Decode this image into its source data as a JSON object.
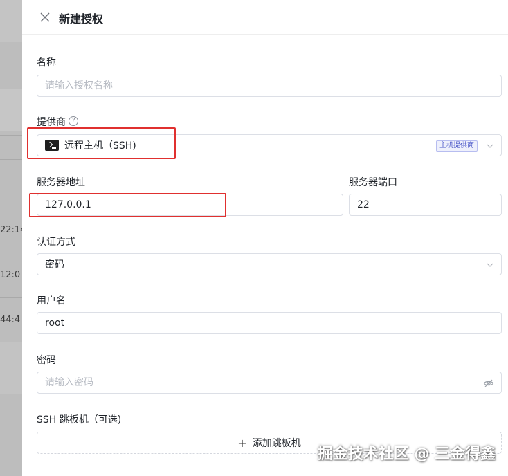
{
  "background": {
    "times": [
      "22:14",
      "12:0",
      "44:4"
    ]
  },
  "drawer": {
    "title": "新建授权"
  },
  "form": {
    "name": {
      "label": "名称",
      "placeholder": "请输入授权名称"
    },
    "provider": {
      "label": "提供商",
      "help": "?",
      "value": "远程主机（SSH)",
      "tag": "主机提供商",
      "icon": "terminal-icon"
    },
    "server_address": {
      "label": "服务器地址",
      "value": "127.0.0.1"
    },
    "server_port": {
      "label": "服务器端口",
      "value": "22"
    },
    "auth_method": {
      "label": "认证方式",
      "value": "密码"
    },
    "username": {
      "label": "用户名",
      "value": "root"
    },
    "password": {
      "label": "密码",
      "placeholder": "请输入密码",
      "icon": "eye-off-icon"
    },
    "jump_host": {
      "label": "SSH 跳板机（可选)",
      "add_label": "添加跳板机"
    }
  },
  "watermark": "掘金技术社区 @ 三金得鑫",
  "colors": {
    "highlight": "#e0302f",
    "tag": "#4a57c8",
    "border": "#dcdfe6"
  }
}
